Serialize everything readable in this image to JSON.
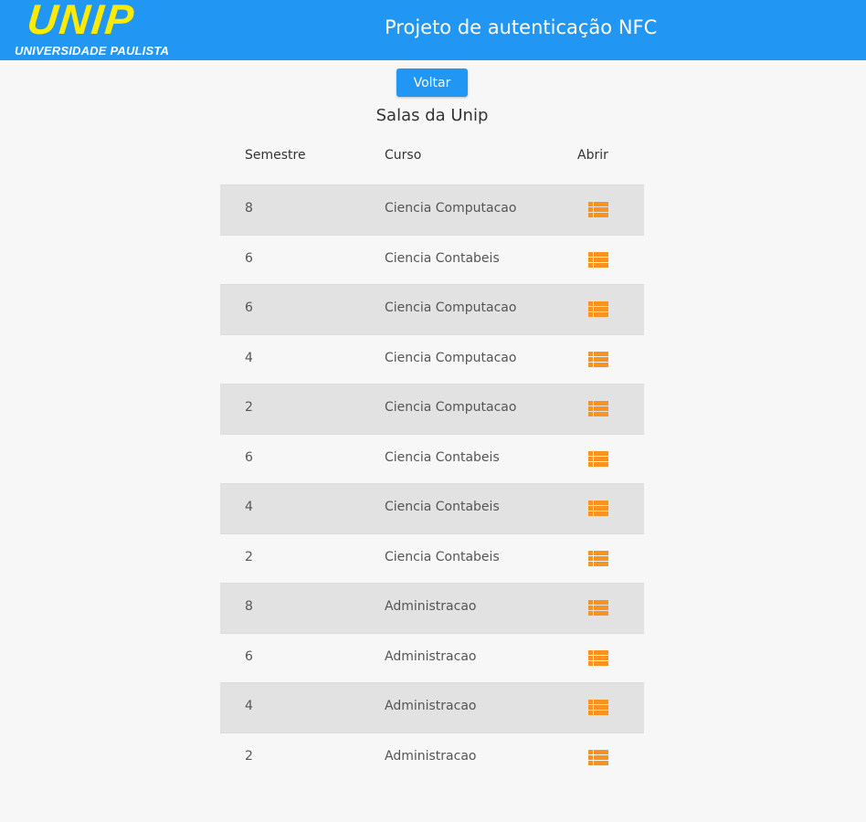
{
  "header": {
    "logo_text": "UNIP",
    "logo_subtext": "UNIVERSIDADE PAULISTA",
    "title": "Projeto de autenticação NFC",
    "bg_color": "#2196f3",
    "logo_color": "#ffeb00"
  },
  "back_button": {
    "label": "Voltar"
  },
  "page_title": "Salas da Unip",
  "table": {
    "columns": [
      "Semestre",
      "Curso",
      "Abrir"
    ],
    "open_icon": "list-icon",
    "icon_color": "#f7931e",
    "rows": [
      {
        "semestre": "8",
        "curso": "Ciencia Computacao"
      },
      {
        "semestre": "6",
        "curso": "Ciencia Contabeis"
      },
      {
        "semestre": "6",
        "curso": "Ciencia Computacao"
      },
      {
        "semestre": "4",
        "curso": "Ciencia Computacao"
      },
      {
        "semestre": "2",
        "curso": "Ciencia Computacao"
      },
      {
        "semestre": "6",
        "curso": "Ciencia Contabeis"
      },
      {
        "semestre": "4",
        "curso": "Ciencia Contabeis"
      },
      {
        "semestre": "2",
        "curso": "Ciencia Contabeis"
      },
      {
        "semestre": "8",
        "curso": "Administracao"
      },
      {
        "semestre": "6",
        "curso": "Administracao"
      },
      {
        "semestre": "4",
        "curso": "Administracao"
      },
      {
        "semestre": "2",
        "curso": "Administracao"
      }
    ]
  }
}
